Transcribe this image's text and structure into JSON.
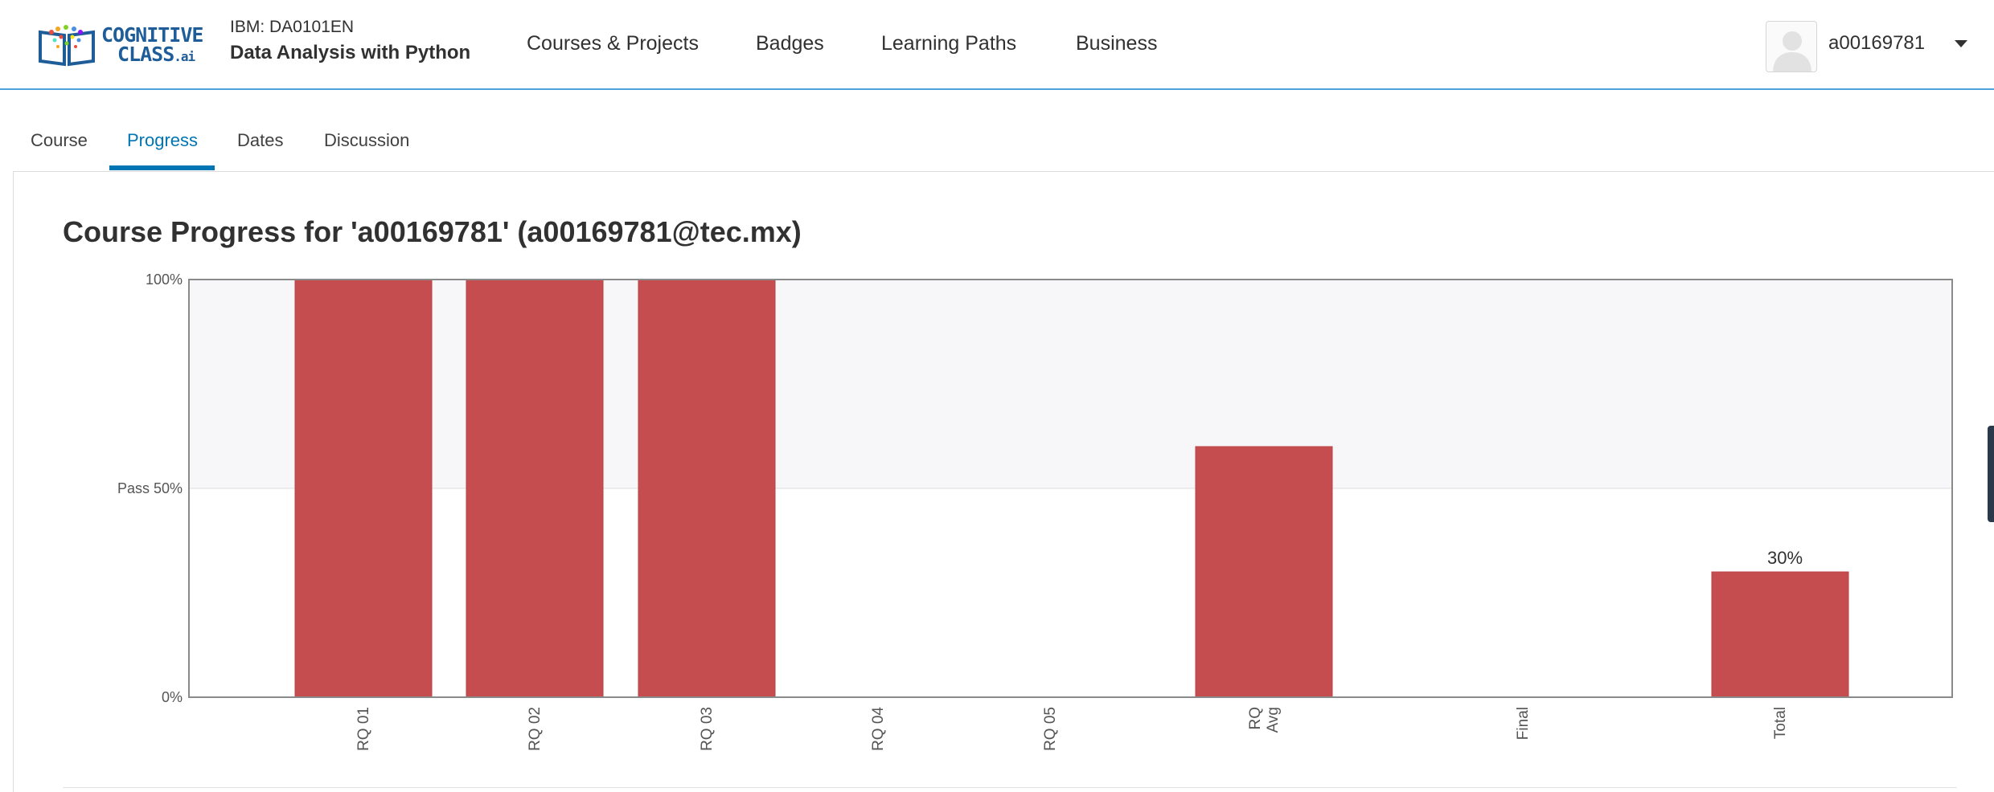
{
  "header": {
    "logo": {
      "line1": "COGNITIVE",
      "line2": "CLASS",
      "suffix": ".ai"
    },
    "course_code": "IBM: DA0101EN",
    "course_name": "Data Analysis with Python",
    "nav": [
      {
        "label": "Courses & Projects"
      },
      {
        "label": "Badges"
      },
      {
        "label": "Learning Paths"
      },
      {
        "label": "Business"
      }
    ],
    "username": "a00169781"
  },
  "tabs": [
    {
      "label": "Course",
      "active": false
    },
    {
      "label": "Progress",
      "active": true
    },
    {
      "label": "Dates",
      "active": false
    },
    {
      "label": "Discussion",
      "active": false
    }
  ],
  "page_title": "Course Progress for 'a00169781' (a00169781@tec.mx)",
  "colors": {
    "bar": "#c54d4f",
    "accent": "#0075b4",
    "pass_band": "#f7f7f9"
  },
  "chart_data": {
    "type": "bar",
    "categories": [
      "RQ 01",
      "RQ 02",
      "RQ 03",
      "RQ 04",
      "RQ 05",
      "RQ\nAvg",
      "Final",
      "Total"
    ],
    "values": [
      100,
      100,
      100,
      0,
      0,
      60,
      0,
      30
    ],
    "ylim": [
      0,
      100
    ],
    "y_ticks": [
      {
        "value": 0,
        "label": "0%"
      },
      {
        "value": 50,
        "label": "Pass 50%"
      },
      {
        "value": 100,
        "label": "100%"
      }
    ],
    "annotations": [
      {
        "category": "Total",
        "label": "30%"
      }
    ],
    "pass_threshold": 50
  }
}
